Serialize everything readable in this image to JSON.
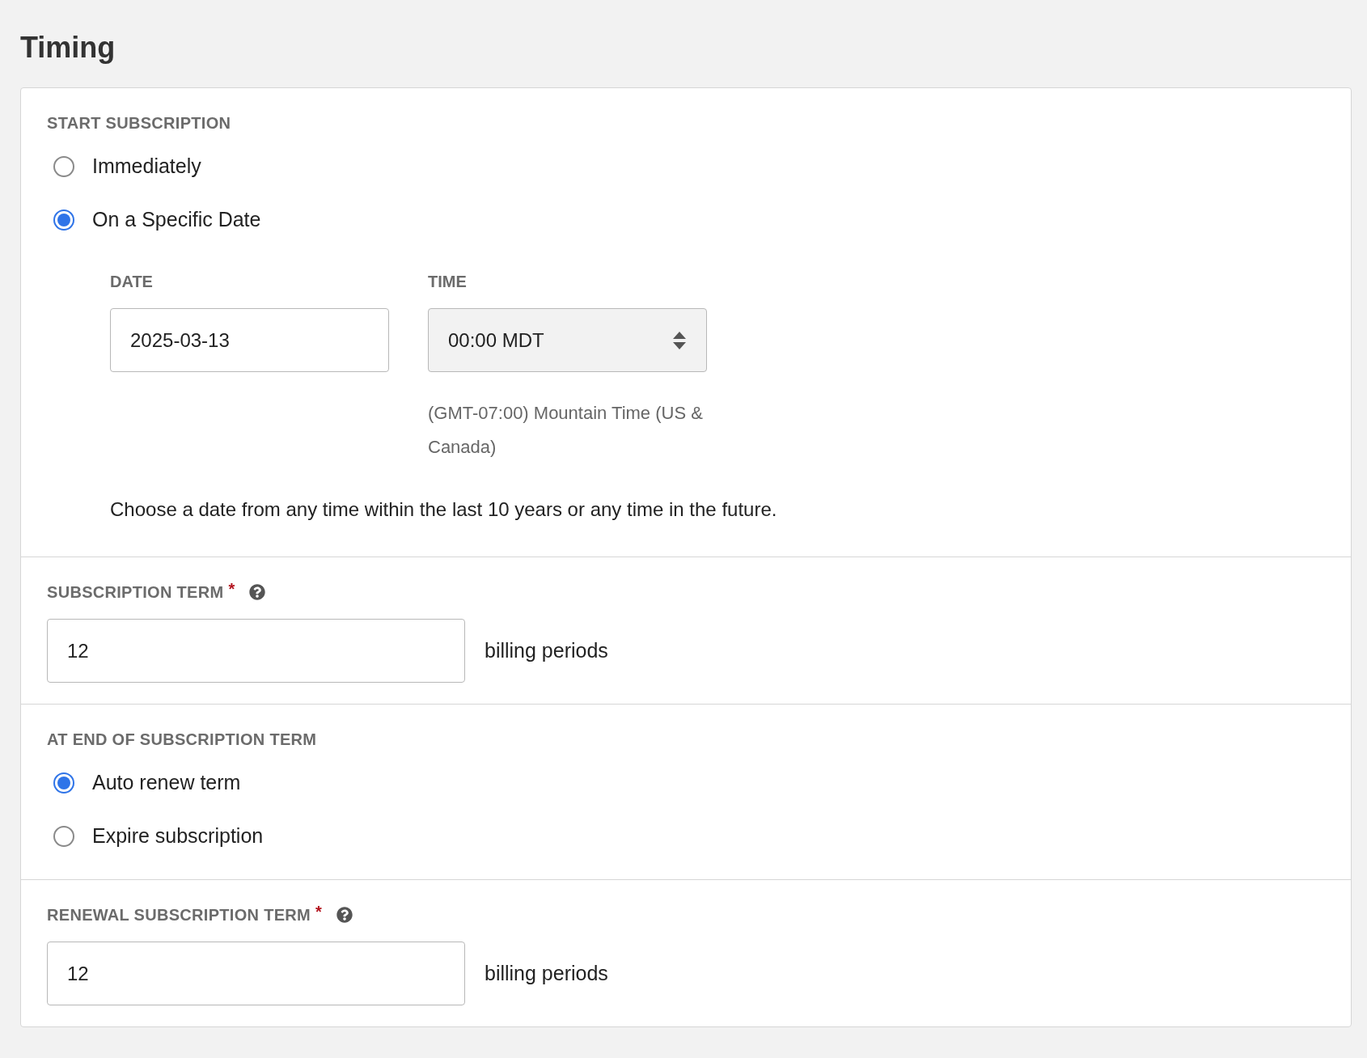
{
  "heading": "Timing",
  "start": {
    "label": "START SUBSCRIPTION",
    "options": [
      {
        "label": "Immediately",
        "selected": false
      },
      {
        "label": "On a Specific Date",
        "selected": true
      }
    ],
    "date": {
      "label": "DATE",
      "value": "2025-03-13"
    },
    "time": {
      "label": "TIME",
      "value": "00:00 MDT",
      "timezone": "(GMT-07:00) Mountain Time (US & Canada)"
    },
    "help": "Choose a date from any time within the last 10 years or any time in the future."
  },
  "term": {
    "label": "SUBSCRIPTION TERM",
    "required_mark": "*",
    "value": "12",
    "unit": "billing periods"
  },
  "end": {
    "label": "AT END OF SUBSCRIPTION TERM",
    "options": [
      {
        "label": "Auto renew term",
        "selected": true
      },
      {
        "label": "Expire subscription",
        "selected": false
      }
    ]
  },
  "renewal": {
    "label": "RENEWAL SUBSCRIPTION TERM",
    "required_mark": "*",
    "value": "12",
    "unit": "billing periods"
  }
}
